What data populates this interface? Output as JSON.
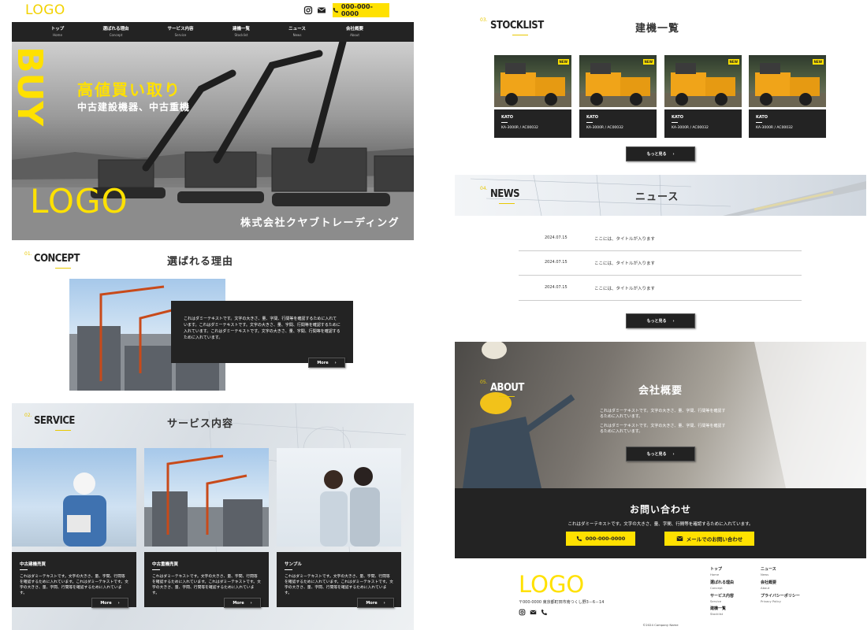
{
  "header": {
    "logo": "LOGO",
    "phone": "000-000-0000"
  },
  "nav": [
    {
      "jp": "トップ",
      "en": "Home"
    },
    {
      "jp": "選ばれる理由",
      "en": "Concept"
    },
    {
      "jp": "サービス内容",
      "en": "Service"
    },
    {
      "jp": "建機一覧",
      "en": "Stocklist"
    },
    {
      "jp": "ニュース",
      "en": "News"
    },
    {
      "jp": "会社概要",
      "en": "About"
    }
  ],
  "hero": {
    "vertical": "BUY",
    "catch": "高値買い取り",
    "sub": "中古建設機器、中古重機",
    "logo": "LOGO",
    "company": "株式会社クヤブトレーディング"
  },
  "concept": {
    "num": "01.",
    "head": "CONCEPT",
    "jp": "選ばれる理由",
    "text": "これはダミーテキストです。文字の大きさ、量、字間、行間等を確認するために入れています。これはダミーテキストです。文字の大きさ、量、字間、行間等を確認するために入れています。これはダミーテキストです。文字の大きさ、量、字間、行間等を確認するために入れています。",
    "more": "More"
  },
  "service": {
    "num": "02.",
    "head": "SERVICE",
    "jp": "サービス内容",
    "cards": [
      {
        "title": "中古建機売買",
        "text": "これはダミーテキストです。文字の大きさ、量、字間、行間等を確認するために入れています。これはダミーテキストです。文字の大きさ、量、字間、行間等を確認するために入れています。",
        "more": "More"
      },
      {
        "title": "中古重機売買",
        "text": "これはダミーテキストです。文字の大きさ、量、字間、行間等を確認するために入れています。これはダミーテキストです。文字の大きさ、量、字間、行間等を確認するために入れています。",
        "more": "More"
      },
      {
        "title": "サンプル",
        "text": "これはダミーテキストです。文字の大きさ、量、字間、行間等を確認するために入れています。これはダミーテキストです。文字の大きさ、量、字間、行間等を確認するために入れています。",
        "more": "More"
      }
    ]
  },
  "stocklist": {
    "num": "03.",
    "head": "STOCKLIST",
    "jp": "建機一覧",
    "badge": "NEW",
    "items": [
      {
        "name": "KATO",
        "model": "KA-3000R / AC00032"
      },
      {
        "name": "KATO",
        "model": "KA-3000R / AC00032"
      },
      {
        "name": "KATO",
        "model": "KA-3000R / AC00032"
      },
      {
        "name": "KATO",
        "model": "KA-3000R / AC00032"
      }
    ],
    "more": "もっと見る"
  },
  "news": {
    "num": "04.",
    "head": "NEWS",
    "jp": "ニュース",
    "items": [
      {
        "date": "2024.07.15",
        "title": "ここには、タイトルが入ります"
      },
      {
        "date": "2024.07.15",
        "title": "ここには、タイトルが入ります"
      },
      {
        "date": "2024.07.15",
        "title": "ここには、タイトルが入ります"
      }
    ],
    "more": "もっと見る"
  },
  "about": {
    "num": "05.",
    "head": "ABOUT",
    "jp": "会社概要",
    "text1": "これはダミーテキストです。文字の大きさ、量、字間、行間等を確認するために入れています。",
    "text2": "これはダミーテキストです。文字の大きさ、量、字間、行間等を確認するために入れています。",
    "more": "もっと見る"
  },
  "contact": {
    "title": "お問い合わせ",
    "text": "これはダミーテキストです。文字の大きさ、量、字間、行間等を確認するために入れています。",
    "phone": "000-000-0000",
    "mail": "メールでのお問い合わせ"
  },
  "footer": {
    "logo": "LOGO",
    "address": "〒000-0000 東京都町田市南つくし野3－6－14",
    "nav": [
      {
        "jp": "トップ",
        "en": "Home"
      },
      {
        "jp": "選ばれる理由",
        "en": "Concept"
      },
      {
        "jp": "サービス内容",
        "en": "Service"
      },
      {
        "jp": "建機一覧",
        "en": "Stocklist"
      },
      {
        "jp": "ニュース",
        "en": "News"
      },
      {
        "jp": "会社概要",
        "en": "About"
      },
      {
        "jp": "プライバシーポリシー",
        "en": "Privacy Policy"
      }
    ],
    "copyright": "©2024 Company Name"
  },
  "colors": {
    "accent": "#ffe100",
    "dark": "#232323"
  },
  "icons": [
    "instagram-icon",
    "mail-icon",
    "phone-icon",
    "chevron-right-icon"
  ]
}
